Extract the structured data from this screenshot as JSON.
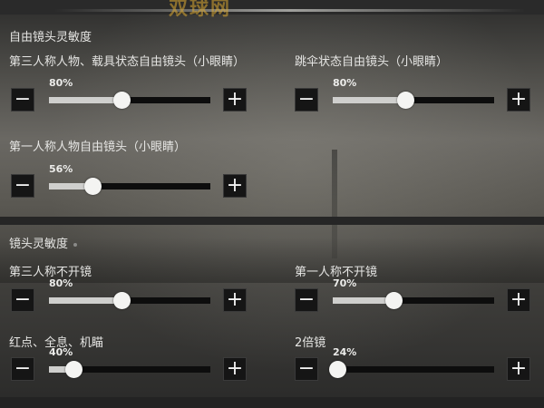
{
  "watermark": "双球网",
  "free_look": {
    "title": "自由镜头灵敏度",
    "items": [
      {
        "label": "第三人称人物、载具状态自由镜头（小眼睛）",
        "value_text": "80%",
        "value": 80
      },
      {
        "label": "跳伞状态自由镜头（小眼睛）",
        "value_text": "80%",
        "value": 80
      },
      {
        "label": "第一人称人物自由镜头（小眼睛）",
        "value_text": "56%",
        "value": 56
      }
    ]
  },
  "camera": {
    "title": "镜头灵敏度",
    "items": [
      {
        "label": "第三人称不开镜",
        "value_text": "80%",
        "value": 80
      },
      {
        "label": "第一人称不开镜",
        "value_text": "70%",
        "value": 70
      },
      {
        "label": "红点、全息、机瞄",
        "value_text": "40%",
        "value": 40
      },
      {
        "label": "2倍镜",
        "value_text": "24%",
        "value": 24
      }
    ]
  },
  "controls": {
    "minus_symbol": "−",
    "plus_symbol": "+"
  }
}
